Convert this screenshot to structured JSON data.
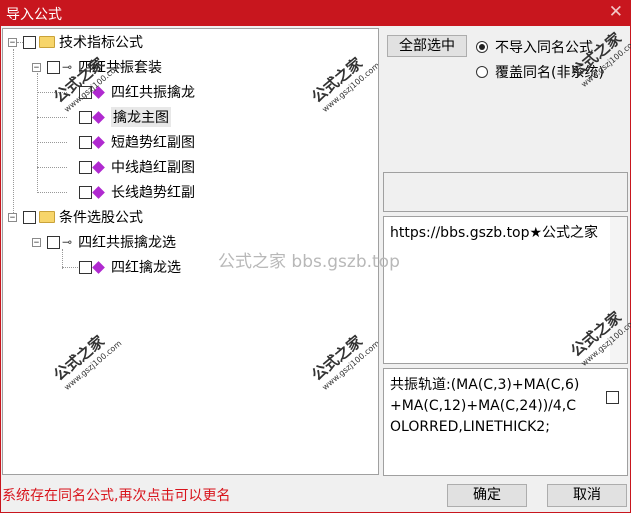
{
  "window": {
    "title": "导入公式",
    "close_glyph": "✕"
  },
  "tree": {
    "nodes": [
      {
        "label": "技术指标公式",
        "type": "folder"
      },
      {
        "label": "四红共振套装",
        "type": "key"
      },
      {
        "label": "四红共振擒龙",
        "type": "formula"
      },
      {
        "label": "擒龙主图",
        "type": "formula",
        "selected": true
      },
      {
        "label": "短趋势红副图",
        "type": "formula"
      },
      {
        "label": "中线趋红副图",
        "type": "formula"
      },
      {
        "label": "长线趋势红副",
        "type": "formula"
      },
      {
        "label": "条件选股公式",
        "type": "folder"
      },
      {
        "label": "四红共振擒龙选",
        "type": "key"
      },
      {
        "label": "四红擒龙选",
        "type": "formula"
      }
    ]
  },
  "watermark": {
    "brand": "公式之家",
    "url": "www.gszj100.com",
    "overlay": "公式之家 bbs.gszb.top"
  },
  "options": {
    "select_all_label": "全部选中",
    "radio_skip_label": "不导入同名公式",
    "radio_overwrite_label": "覆盖同名(非系统)",
    "selected": "skip"
  },
  "description_text": "https://bbs.gszb.top★公式之家",
  "formula_text": "共振轨道:(MA(C,3)+MA(C,6)+MA(C,12)+MA(C,24))/4,COLORRED,LINETHICK2;",
  "status_message": "系统存在同名公式,再次点击可以更名",
  "buttons": {
    "ok_label": "确定",
    "cancel_label": "取消"
  }
}
